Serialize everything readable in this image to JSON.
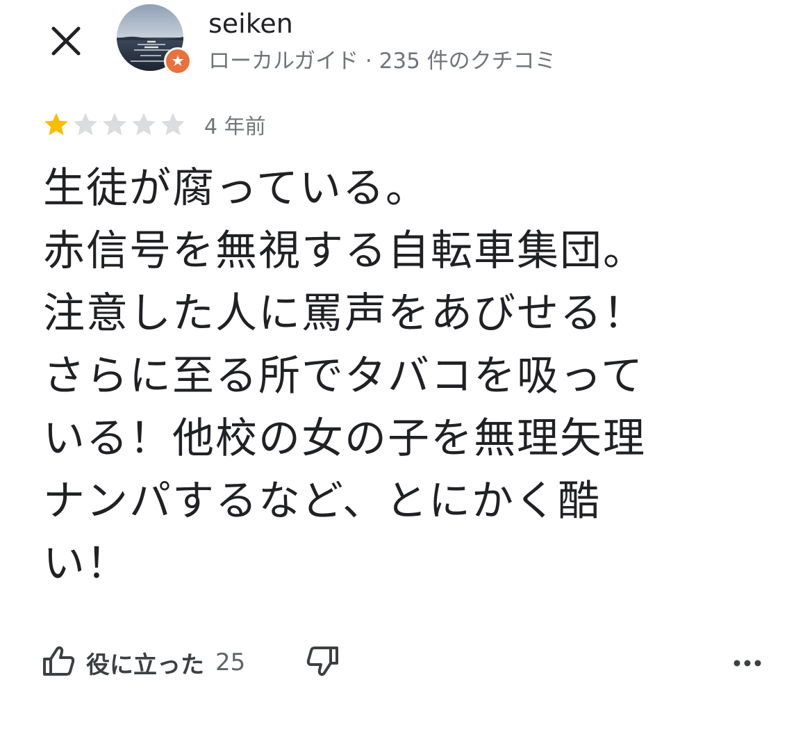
{
  "reviewer": {
    "name": "seiken",
    "meta": "ローカルガイド · 235 件のクチコミ"
  },
  "review": {
    "rating": 1,
    "max_rating": 5,
    "time": "4 年前",
    "text_lines": [
      "生徒が腐っている。",
      "赤信号を無視する自転車集団。",
      "注意した人に罵声をあびせる！",
      "さらに至る所でタバコを吸って",
      "いる！他校の女の子を無理矢理",
      "ナンパするなど、とにかく酷",
      "い！"
    ]
  },
  "actions": {
    "helpful_label": "役に立った",
    "helpful_count": "25"
  },
  "icons": {
    "close": "close-icon",
    "badge": "local-guide-badge-icon",
    "helpful": "thumbs-up-icon",
    "unhelpful": "thumbs-down-icon",
    "more": "more-horizontal-icon"
  },
  "colors": {
    "star_filled": "#fbbc04",
    "star_empty": "#dadce0",
    "badge": "#e8713c",
    "text_primary": "#202124",
    "text_secondary": "#70757a"
  }
}
